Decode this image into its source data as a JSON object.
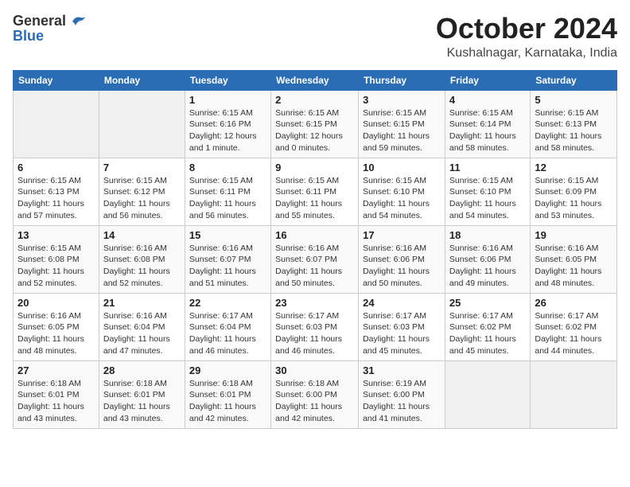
{
  "header": {
    "logo_general": "General",
    "logo_blue": "Blue",
    "month": "October 2024",
    "location": "Kushalnagar, Karnataka, India"
  },
  "calendar": {
    "days_of_week": [
      "Sunday",
      "Monday",
      "Tuesday",
      "Wednesday",
      "Thursday",
      "Friday",
      "Saturday"
    ],
    "weeks": [
      [
        {
          "day": "",
          "info": ""
        },
        {
          "day": "",
          "info": ""
        },
        {
          "day": "1",
          "info": "Sunrise: 6:15 AM\nSunset: 6:16 PM\nDaylight: 12 hours\nand 1 minute."
        },
        {
          "day": "2",
          "info": "Sunrise: 6:15 AM\nSunset: 6:15 PM\nDaylight: 12 hours\nand 0 minutes."
        },
        {
          "day": "3",
          "info": "Sunrise: 6:15 AM\nSunset: 6:15 PM\nDaylight: 11 hours\nand 59 minutes."
        },
        {
          "day": "4",
          "info": "Sunrise: 6:15 AM\nSunset: 6:14 PM\nDaylight: 11 hours\nand 58 minutes."
        },
        {
          "day": "5",
          "info": "Sunrise: 6:15 AM\nSunset: 6:13 PM\nDaylight: 11 hours\nand 58 minutes."
        }
      ],
      [
        {
          "day": "6",
          "info": "Sunrise: 6:15 AM\nSunset: 6:13 PM\nDaylight: 11 hours\nand 57 minutes."
        },
        {
          "day": "7",
          "info": "Sunrise: 6:15 AM\nSunset: 6:12 PM\nDaylight: 11 hours\nand 56 minutes."
        },
        {
          "day": "8",
          "info": "Sunrise: 6:15 AM\nSunset: 6:11 PM\nDaylight: 11 hours\nand 56 minutes."
        },
        {
          "day": "9",
          "info": "Sunrise: 6:15 AM\nSunset: 6:11 PM\nDaylight: 11 hours\nand 55 minutes."
        },
        {
          "day": "10",
          "info": "Sunrise: 6:15 AM\nSunset: 6:10 PM\nDaylight: 11 hours\nand 54 minutes."
        },
        {
          "day": "11",
          "info": "Sunrise: 6:15 AM\nSunset: 6:10 PM\nDaylight: 11 hours\nand 54 minutes."
        },
        {
          "day": "12",
          "info": "Sunrise: 6:15 AM\nSunset: 6:09 PM\nDaylight: 11 hours\nand 53 minutes."
        }
      ],
      [
        {
          "day": "13",
          "info": "Sunrise: 6:15 AM\nSunset: 6:08 PM\nDaylight: 11 hours\nand 52 minutes."
        },
        {
          "day": "14",
          "info": "Sunrise: 6:16 AM\nSunset: 6:08 PM\nDaylight: 11 hours\nand 52 minutes."
        },
        {
          "day": "15",
          "info": "Sunrise: 6:16 AM\nSunset: 6:07 PM\nDaylight: 11 hours\nand 51 minutes."
        },
        {
          "day": "16",
          "info": "Sunrise: 6:16 AM\nSunset: 6:07 PM\nDaylight: 11 hours\nand 50 minutes."
        },
        {
          "day": "17",
          "info": "Sunrise: 6:16 AM\nSunset: 6:06 PM\nDaylight: 11 hours\nand 50 minutes."
        },
        {
          "day": "18",
          "info": "Sunrise: 6:16 AM\nSunset: 6:06 PM\nDaylight: 11 hours\nand 49 minutes."
        },
        {
          "day": "19",
          "info": "Sunrise: 6:16 AM\nSunset: 6:05 PM\nDaylight: 11 hours\nand 48 minutes."
        }
      ],
      [
        {
          "day": "20",
          "info": "Sunrise: 6:16 AM\nSunset: 6:05 PM\nDaylight: 11 hours\nand 48 minutes."
        },
        {
          "day": "21",
          "info": "Sunrise: 6:16 AM\nSunset: 6:04 PM\nDaylight: 11 hours\nand 47 minutes."
        },
        {
          "day": "22",
          "info": "Sunrise: 6:17 AM\nSunset: 6:04 PM\nDaylight: 11 hours\nand 46 minutes."
        },
        {
          "day": "23",
          "info": "Sunrise: 6:17 AM\nSunset: 6:03 PM\nDaylight: 11 hours\nand 46 minutes."
        },
        {
          "day": "24",
          "info": "Sunrise: 6:17 AM\nSunset: 6:03 PM\nDaylight: 11 hours\nand 45 minutes."
        },
        {
          "day": "25",
          "info": "Sunrise: 6:17 AM\nSunset: 6:02 PM\nDaylight: 11 hours\nand 45 minutes."
        },
        {
          "day": "26",
          "info": "Sunrise: 6:17 AM\nSunset: 6:02 PM\nDaylight: 11 hours\nand 44 minutes."
        }
      ],
      [
        {
          "day": "27",
          "info": "Sunrise: 6:18 AM\nSunset: 6:01 PM\nDaylight: 11 hours\nand 43 minutes."
        },
        {
          "day": "28",
          "info": "Sunrise: 6:18 AM\nSunset: 6:01 PM\nDaylight: 11 hours\nand 43 minutes."
        },
        {
          "day": "29",
          "info": "Sunrise: 6:18 AM\nSunset: 6:01 PM\nDaylight: 11 hours\nand 42 minutes."
        },
        {
          "day": "30",
          "info": "Sunrise: 6:18 AM\nSunset: 6:00 PM\nDaylight: 11 hours\nand 42 minutes."
        },
        {
          "day": "31",
          "info": "Sunrise: 6:19 AM\nSunset: 6:00 PM\nDaylight: 11 hours\nand 41 minutes."
        },
        {
          "day": "",
          "info": ""
        },
        {
          "day": "",
          "info": ""
        }
      ]
    ]
  }
}
